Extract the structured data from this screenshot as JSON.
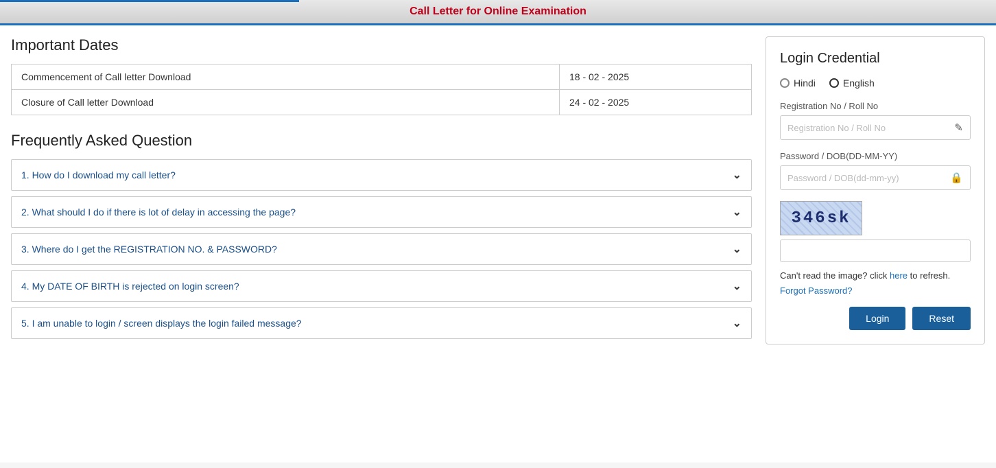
{
  "header": {
    "title": "Call Letter for Online Examination"
  },
  "important_dates": {
    "section_title": "Important Dates",
    "rows": [
      {
        "label": "Commencement of Call letter Download",
        "date": "18 - 02 - 2025"
      },
      {
        "label": "Closure of Call letter Download",
        "date": "24 - 02 - 2025"
      }
    ]
  },
  "faq": {
    "section_title": "Frequently Asked Question",
    "items": [
      {
        "id": 1,
        "question": "1. How do I download my call letter?"
      },
      {
        "id": 2,
        "question": "2. What should I do if there is lot of delay in accessing the page?"
      },
      {
        "id": 3,
        "question": "3. Where do I get the REGISTRATION NO. & PASSWORD?"
      },
      {
        "id": 4,
        "question": "4. My DATE OF BIRTH is rejected on login screen?"
      },
      {
        "id": 5,
        "question": "5. I am unable to login / screen displays the login failed message?"
      }
    ]
  },
  "login": {
    "section_title": "Login Credential",
    "language_options": [
      "Hindi",
      "English"
    ],
    "selected_language": "English",
    "registration_label": "Registration No / Roll No",
    "registration_placeholder": "Registration No / Roll No",
    "password_label": "Password / DOB(DD-MM-YY)",
    "password_placeholder": "Password / DOB(dd-mm-yy)",
    "captcha_text": "346sk",
    "captcha_hint_prefix": "Can't read the image? click ",
    "captcha_hint_link": "here",
    "captcha_hint_suffix": " to refresh.",
    "forgot_password_label": "Forgot Password?",
    "login_button": "Login",
    "reset_button": "Reset"
  }
}
